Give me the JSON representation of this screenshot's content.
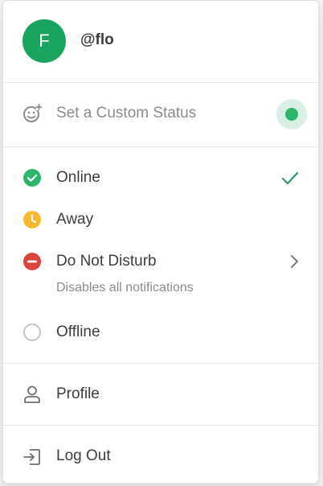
{
  "user": {
    "avatar_letter": "F",
    "username": "@flo"
  },
  "custom_status": {
    "label": "Set a Custom Status"
  },
  "statuses": [
    {
      "label": "Online",
      "icon": "online-check-circle-icon",
      "color": "#2db56b",
      "selected": true
    },
    {
      "label": "Away",
      "icon": "away-clock-icon",
      "color": "#f5b82e"
    },
    {
      "label": "Do Not Disturb",
      "icon": "dnd-minus-circle-icon",
      "color": "#d9453d",
      "sublabel": "Disables all notifications"
    },
    {
      "label": "Offline",
      "icon": "offline-circle-icon",
      "color": "#c4c6cc"
    }
  ],
  "account": {
    "profile_label": "Profile",
    "logout_label": "Log Out"
  },
  "colors": {
    "avatar_bg": "#1aa35f",
    "accent_green": "#2db56b"
  }
}
